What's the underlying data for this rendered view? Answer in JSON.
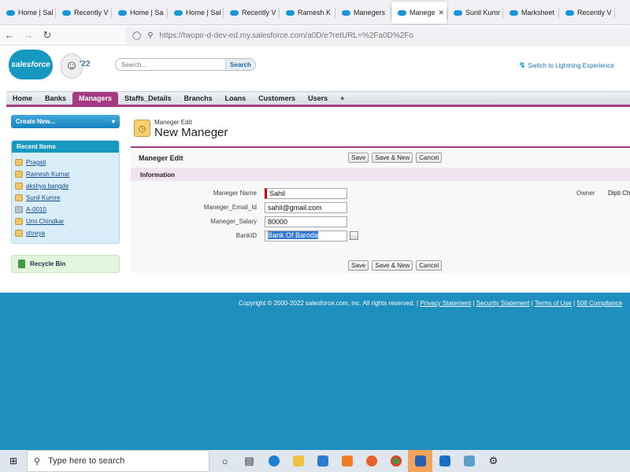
{
  "browser": {
    "tabs": [
      {
        "label": "Home | Sal",
        "active": false
      },
      {
        "label": "Recently V",
        "active": false
      },
      {
        "label": "Home | Sa",
        "active": false
      },
      {
        "label": "Home | Sal",
        "active": false
      },
      {
        "label": "Recently V",
        "active": false
      },
      {
        "label": "Ramesh K",
        "active": false
      },
      {
        "label": "Manegers",
        "active": false
      },
      {
        "label": "Manege",
        "active": true
      },
      {
        "label": "Sunil Kumr",
        "active": false
      },
      {
        "label": "Marksheet",
        "active": false
      },
      {
        "label": "Recently V",
        "active": false
      }
    ],
    "url": "https://twopir-d-dev-ed.my.salesforce.com/a0D/e?retURL=%2Fa0D%2Fo"
  },
  "header": {
    "logo_text": "salesforce",
    "release_badge": "'22",
    "search_placeholder": "Search...",
    "search_button": "Search",
    "lightning_link": "Switch to Lightning Experience"
  },
  "nav_tabs": [
    {
      "label": "Home",
      "active": false
    },
    {
      "label": "Banks",
      "active": false
    },
    {
      "label": "Managers",
      "active": true
    },
    {
      "label": "Staffs_Details",
      "active": false
    },
    {
      "label": "Branchs",
      "active": false
    },
    {
      "label": "Loans",
      "active": false
    },
    {
      "label": "Customers",
      "active": false
    },
    {
      "label": "Users",
      "active": false
    },
    {
      "label": "+",
      "active": false
    }
  ],
  "sidebar": {
    "create_new": "Create New...",
    "recent_title": "Recent Items",
    "recent_items": [
      {
        "label": "Pragati",
        "icon": "manager-icon"
      },
      {
        "label": "Ramesh Kumar",
        "icon": "manager-icon"
      },
      {
        "label": "akshya bangde",
        "icon": "manager-icon"
      },
      {
        "label": "Sunil Kumre",
        "icon": "manager-icon"
      },
      {
        "label": "A-0010",
        "icon": "record-icon"
      },
      {
        "label": "Umi Chindkar",
        "icon": "staff-icon"
      },
      {
        "label": "shreya",
        "icon": "staff-icon"
      }
    ],
    "recycle_bin": "Recycle Bin"
  },
  "main": {
    "title_sub": "Maneger Edit",
    "title": "New Maneger",
    "block_title": "Maneger Edit",
    "buttons": {
      "save": "Save",
      "save_new": "Save & New",
      "cancel": "Cancel"
    },
    "section_title": "Information",
    "fields": [
      {
        "label": "Maneger Name",
        "value": "Sahil",
        "required": true
      },
      {
        "label": "Maneger_Email_Id",
        "value": "sahil@gmail.com",
        "required": false
      },
      {
        "label": "Maneger_Salary",
        "value": "80000",
        "required": false
      },
      {
        "label": "BankID",
        "value": "Bank Of Baroda",
        "required": false
      }
    ],
    "owner_label": "Owner",
    "owner_value": "Dipti Ch"
  },
  "footer": {
    "copyright": "Copyright © 2000-2022 salesforce.com, inc. All rights reserved. | ",
    "privacy": "Privacy Statement",
    "security": "Security Statement",
    "terms": "Terms of Use",
    "compliance": "508 Compliance"
  },
  "taskbar": {
    "search_placeholder": "Type here to search"
  },
  "colors": {
    "accent_managers": "#a33a82",
    "salesforce_blue": "#1798c1",
    "page_background": "#1e8fbf"
  }
}
